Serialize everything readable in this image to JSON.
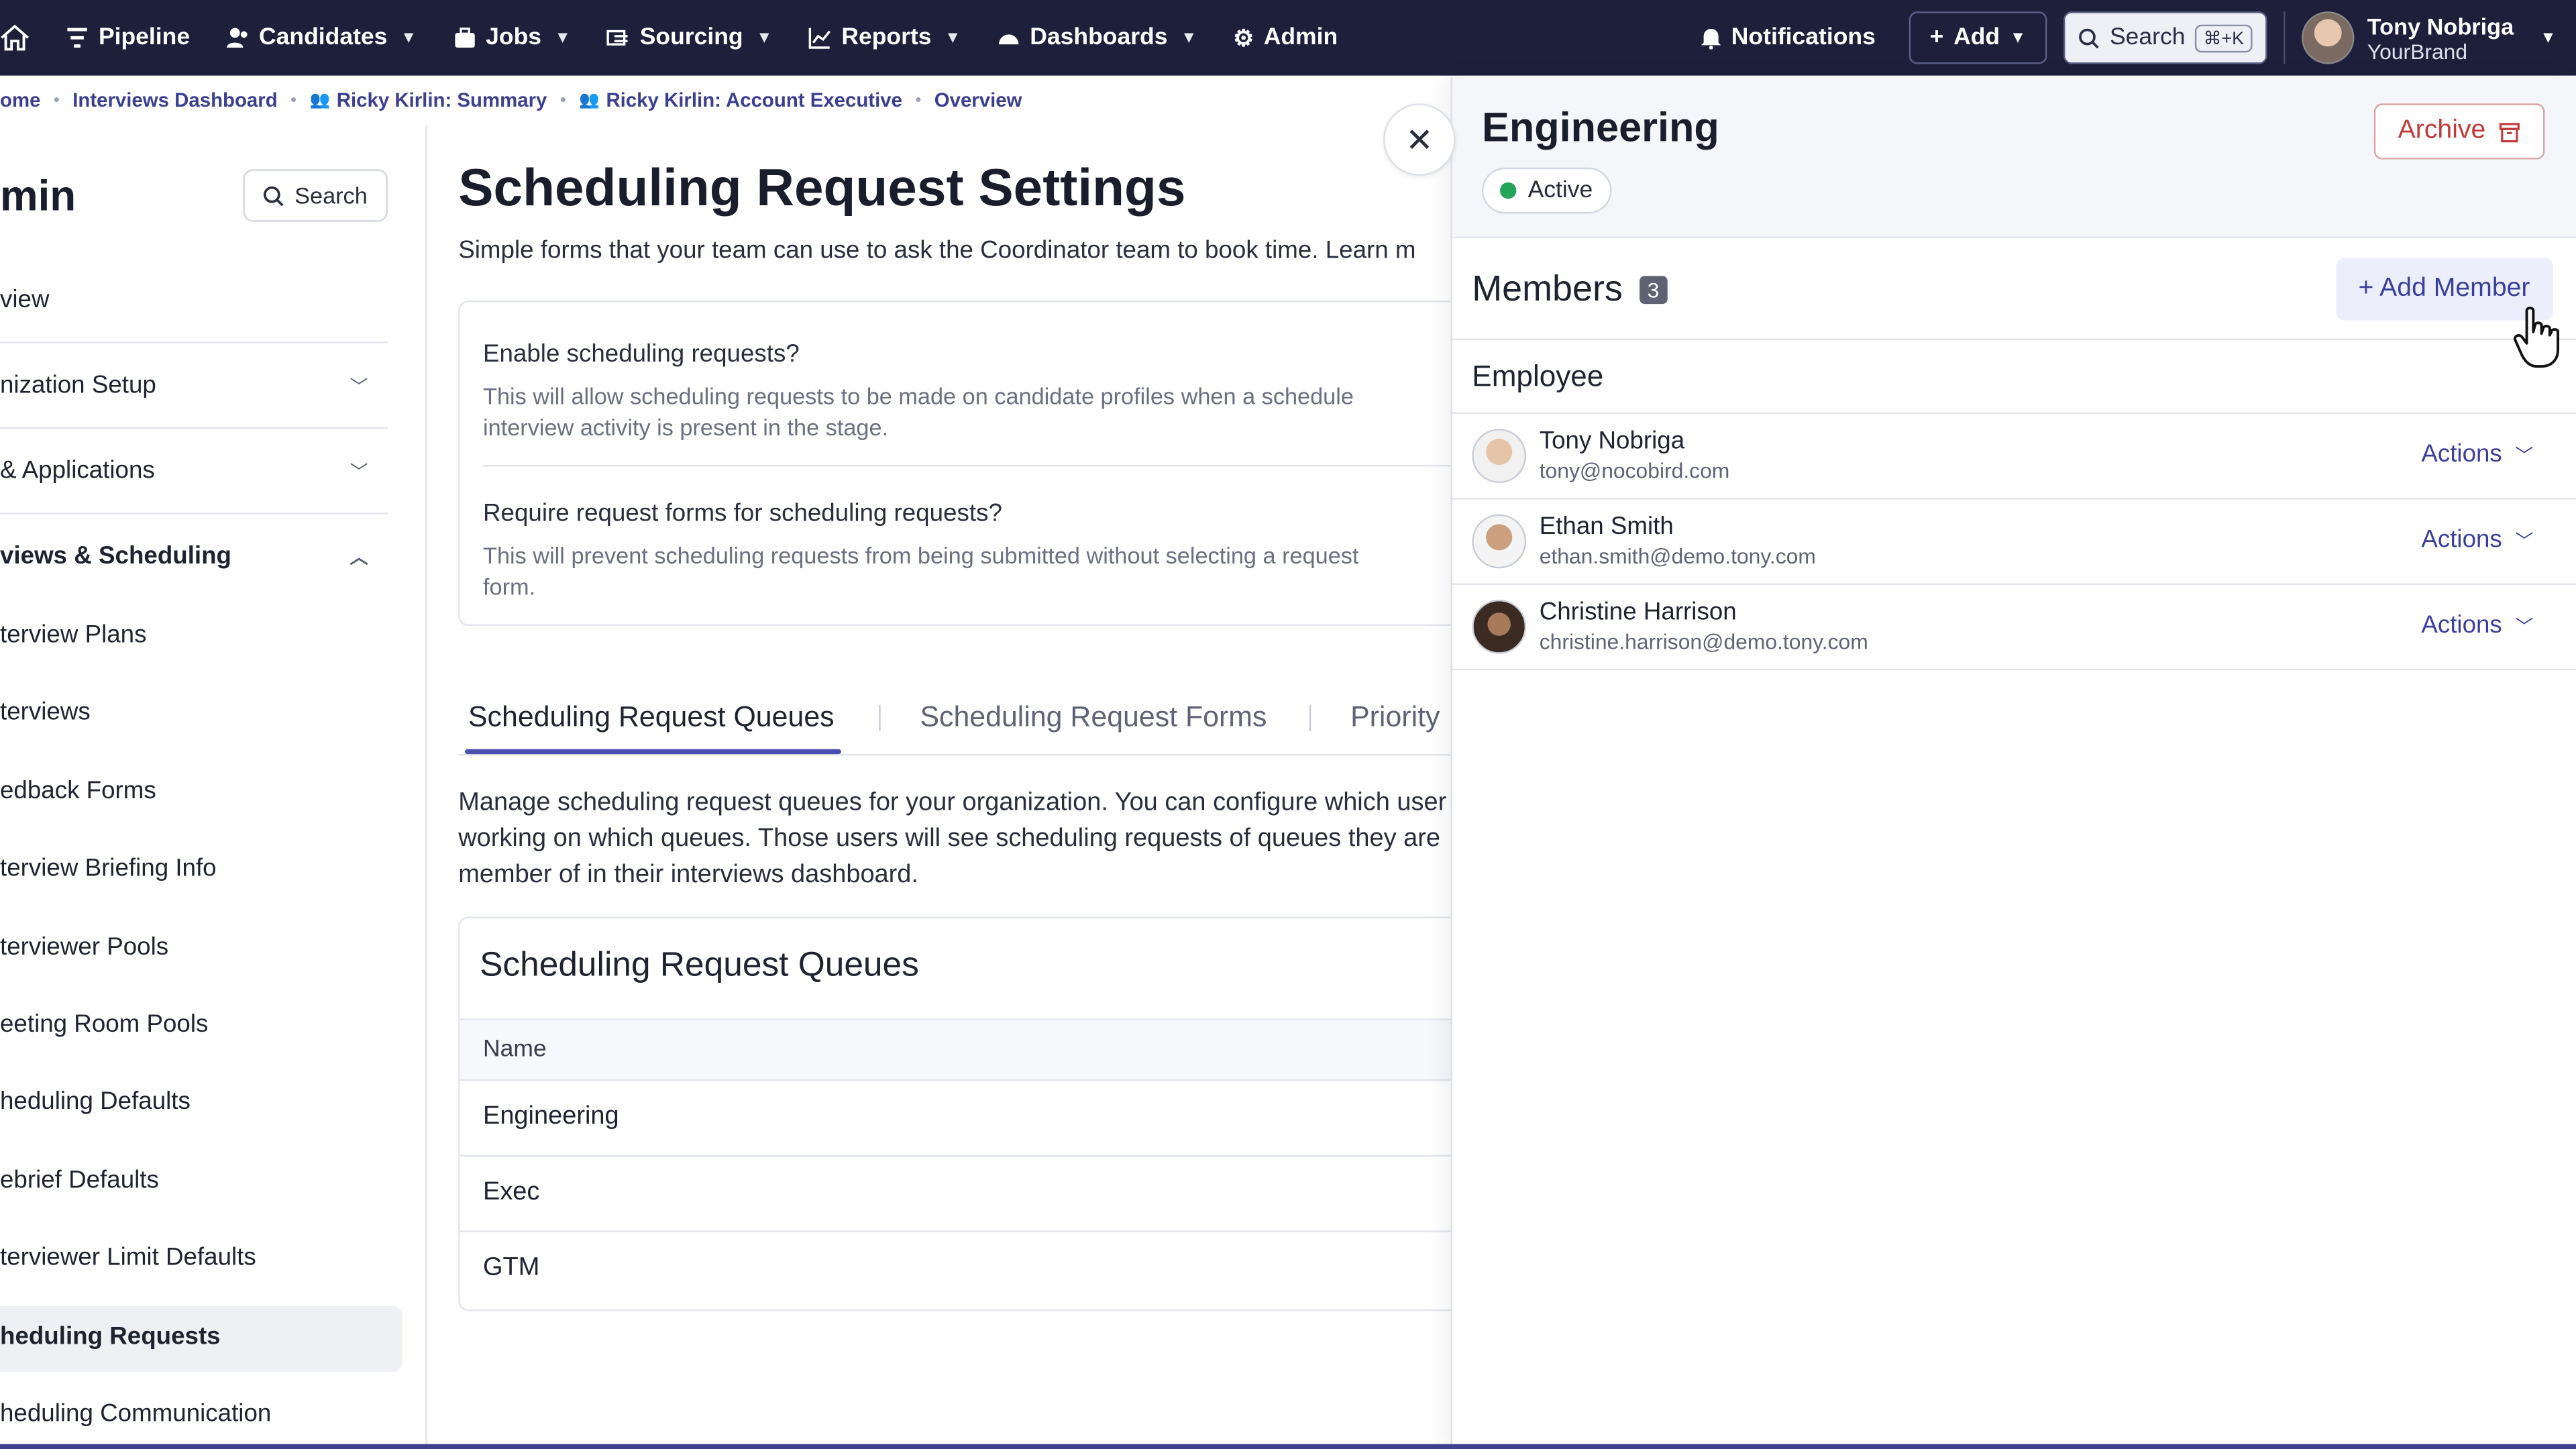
{
  "nav": {
    "items": [
      {
        "label": "Pipeline",
        "icon": "filter-icon",
        "chevron": false
      },
      {
        "label": "Candidates",
        "icon": "people-icon",
        "chevron": true
      },
      {
        "label": "Jobs",
        "icon": "briefcase-icon",
        "chevron": true
      },
      {
        "label": "Sourcing",
        "icon": "sourcing-icon",
        "chevron": true
      },
      {
        "label": "Reports",
        "icon": "chart-icon",
        "chevron": true
      },
      {
        "label": "Dashboards",
        "icon": "gauge-icon",
        "chevron": true
      },
      {
        "label": "Admin",
        "icon": "gear-icon",
        "chevron": false
      }
    ],
    "notifications": "Notifications",
    "add": "Add",
    "search": "Search",
    "shortcut": "⌘+K",
    "user_name": "Tony Nobriga",
    "user_org": "YourBrand"
  },
  "breadcrumb": [
    "ome",
    "Interviews Dashboard",
    "Ricky Kirlin: Summary",
    "Ricky Kirlin: Account Executive",
    "Overview"
  ],
  "sidebar": {
    "title": "min",
    "search": "Search",
    "items": [
      {
        "label": "view",
        "type": "link"
      },
      {
        "label": "nization Setup",
        "type": "section",
        "chevron": "down"
      },
      {
        "label": "& Applications",
        "type": "section",
        "chevron": "down"
      },
      {
        "label": "views & Scheduling",
        "type": "section-open",
        "chevron": "up"
      },
      {
        "label": "terview Plans",
        "type": "link"
      },
      {
        "label": "terviews",
        "type": "link"
      },
      {
        "label": "edback Forms",
        "type": "link"
      },
      {
        "label": "terview Briefing Info",
        "type": "link"
      },
      {
        "label": "terviewer Pools",
        "type": "link"
      },
      {
        "label": "eeting Room Pools",
        "type": "link"
      },
      {
        "label": "heduling Defaults",
        "type": "link"
      },
      {
        "label": "ebrief Defaults",
        "type": "link"
      },
      {
        "label": "terviewer Limit Defaults",
        "type": "link"
      },
      {
        "label": "heduling Requests",
        "type": "active"
      },
      {
        "label": "heduling Communication",
        "type": "link"
      }
    ]
  },
  "main": {
    "title": "Scheduling Request Settings",
    "subtitle": "Simple forms that your team can use to ask the Coordinator team to book time. Learn m",
    "settings": [
      {
        "question": "Enable scheduling requests?",
        "description": "This will allow scheduling requests to be made on candidate profiles when a schedule interview activity is present in the stage."
      },
      {
        "question": "Require request forms for scheduling requests?",
        "description": "This will prevent scheduling requests from being submitted without selecting a request form."
      }
    ],
    "tabs": [
      "Scheduling Request Queues",
      "Scheduling Request Forms",
      "Priority"
    ],
    "manage_text": "Manage scheduling request queues for your organization. You can configure which user working on which queues. Those users will see scheduling requests of queues they are member of in their interviews dashboard.",
    "queues_title": "Scheduling Request Queues",
    "queues_header": "Name",
    "queues": [
      "Engineering",
      "Exec",
      "GTM"
    ]
  },
  "panel": {
    "title": "Engineering",
    "status": "Active",
    "archive": "Archive",
    "members_label": "Members",
    "members_count": "3",
    "add_member": "+ Add Member",
    "group": "Employee",
    "members": [
      {
        "name": "Tony Nobriga",
        "email": "tony@nocobird.com",
        "action": "Actions"
      },
      {
        "name": "Ethan Smith",
        "email": "ethan.smith@demo.tony.com",
        "action": "Actions"
      },
      {
        "name": "Christine Harrison",
        "email": "christine.harrison@demo.tony.com",
        "action": "Actions"
      }
    ]
  },
  "colors": {
    "nav_bg": "#1d1f3b",
    "accent": "#3a3f9c",
    "danger": "#c23b3b",
    "active_green": "#22a45a"
  }
}
